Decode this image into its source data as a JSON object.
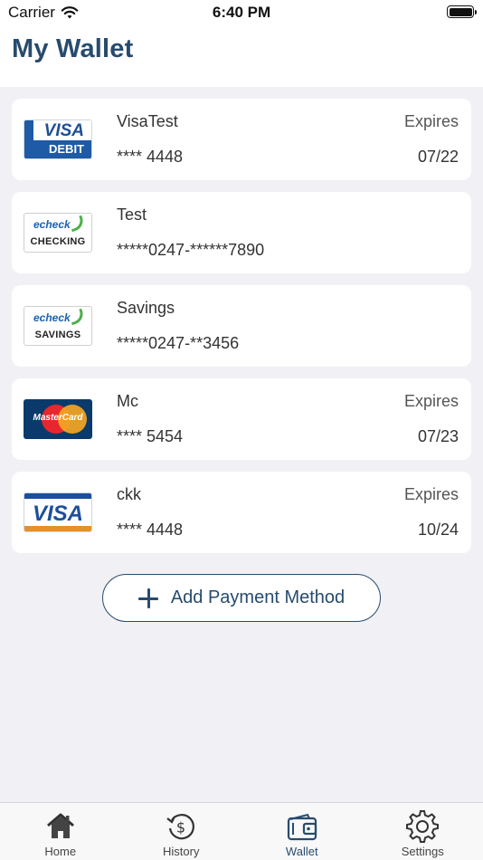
{
  "status_bar": {
    "carrier": "Carrier",
    "time": "6:40 PM"
  },
  "header": {
    "title": "My Wallet"
  },
  "cards": [
    {
      "logo": "visa-debit-logo",
      "logo_text": [
        "VISA",
        "DEBIT"
      ],
      "name": "VisaTest",
      "number": "**** 4448",
      "expires_label": "Expires",
      "expires": "07/22"
    },
    {
      "logo": "echeck-checking-logo",
      "logo_text": [
        "echeck",
        "CHECKING"
      ],
      "name": "Test",
      "number": "*****0247-******7890",
      "expires_label": "",
      "expires": ""
    },
    {
      "logo": "echeck-savings-logo",
      "logo_text": [
        "echeck",
        "SAVINGS"
      ],
      "name": "Savings",
      "number": "*****0247-**3456",
      "expires_label": "",
      "expires": ""
    },
    {
      "logo": "mastercard-logo",
      "logo_text": [
        "MasterCard"
      ],
      "name": "Mc",
      "number": "**** 5454",
      "expires_label": "Expires",
      "expires": "07/23"
    },
    {
      "logo": "visa-logo",
      "logo_text": [
        "VISA"
      ],
      "name": "ckk",
      "number": "**** 4448",
      "expires_label": "Expires",
      "expires": "10/24"
    }
  ],
  "add_button": {
    "label": "Add Payment Method",
    "icon": "plus-icon"
  },
  "tab_bar": {
    "tabs": [
      {
        "label": "Home",
        "icon": "home-icon"
      },
      {
        "label": "History",
        "icon": "history-icon"
      },
      {
        "label": "Wallet",
        "icon": "wallet-icon",
        "active": true
      },
      {
        "label": "Settings",
        "icon": "gear-icon"
      }
    ]
  },
  "colors": {
    "brand": "#274b6e",
    "background": "#f1f1f5",
    "card": "#ffffff"
  }
}
